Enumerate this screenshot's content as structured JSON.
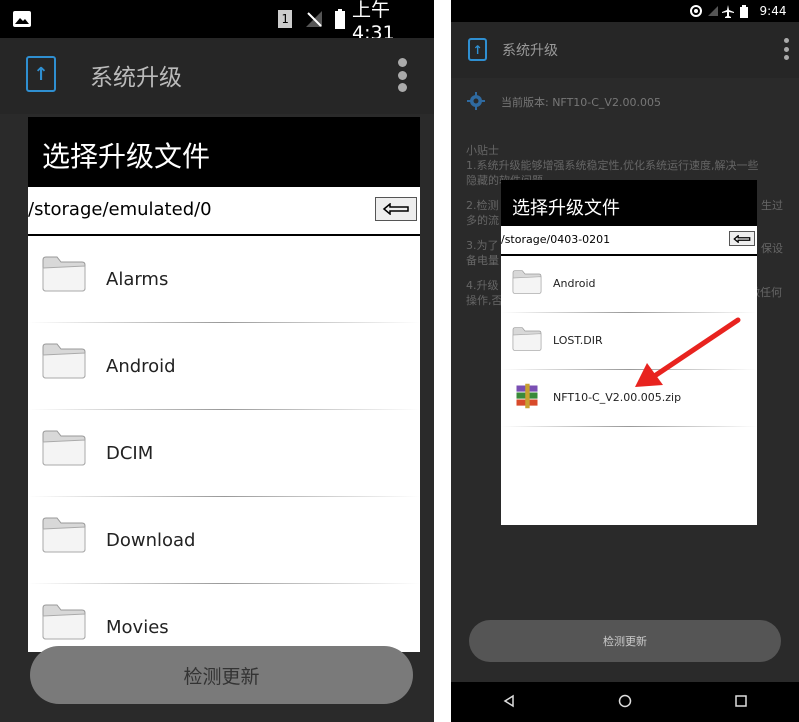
{
  "left": {
    "status": {
      "sim": "1",
      "time": "上午4:31"
    },
    "app": {
      "title": "系统升级"
    },
    "dialog": {
      "title": "选择升级文件",
      "path": "/storage/emulated/0",
      "items": [
        "Alarms",
        "Android",
        "DCIM",
        "Download",
        "Movies"
      ]
    },
    "check_button": "检测更新"
  },
  "right": {
    "status": {
      "time": "9:44"
    },
    "app": {
      "title": "系统升级"
    },
    "version_line": "当前版本: NFT10-C_V2.00.005",
    "tips": {
      "heading": "小贴士",
      "lines": [
        "1.系统升级能够增强系统稳定性,优化系统运行速度,解决一些",
        "隐藏的软件问题。",
        "2.检测",
        "多的流",
        "3.为了",
        "备电量",
        "4.升级",
        "操作,否"
      ],
      "right_fragments": [
        "生过",
        "保设",
        "做任何"
      ]
    },
    "dialog": {
      "title": "选择升级文件",
      "path": "/storage/0403-0201",
      "items": [
        "Android",
        "LOST.DIR",
        "NFT10-C_V2.00.005.zip"
      ]
    },
    "check_button": "检测更新",
    "colors": {
      "arrow": "#e8231f",
      "accent": "#2f8fd1"
    }
  }
}
